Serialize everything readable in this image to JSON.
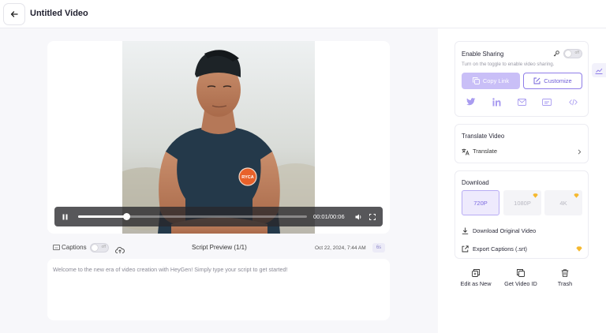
{
  "header": {
    "title": "Untitled Video",
    "back_icon": "arrow-left-icon"
  },
  "player": {
    "current_time": "00:01",
    "duration": "00:06",
    "time_display": "00:01/00:06",
    "progress": 0.21,
    "avatar_badge": "RYCA"
  },
  "below_video": {
    "captions_label": "Captions",
    "captions_toggle_text": "off",
    "script_preview": "Script Preview (1/1)",
    "date": "Oct 22, 2024, 7:44 AM",
    "duration_badge": "6s"
  },
  "script": {
    "text": "Welcome to the new era of video creation with HeyGen! Simply type your script to get started!"
  },
  "sharing": {
    "title": "Enable Sharing",
    "hint": "Turn on the toggle to enable video sharing.",
    "toggle_text": "off",
    "copy_link": "Copy Link",
    "customize": "Customize",
    "icons": [
      "twitter-icon",
      "linkedin-icon",
      "mail-icon",
      "embed-icon",
      "code-icon"
    ]
  },
  "translate": {
    "title": "Translate Video",
    "item": "Translate"
  },
  "download": {
    "title": "Download",
    "resolutions": [
      {
        "label": "720P",
        "selected": true,
        "premium": false
      },
      {
        "label": "1080P",
        "selected": false,
        "premium": true
      },
      {
        "label": "4K",
        "selected": false,
        "premium": true
      }
    ],
    "original": "Download Original Video",
    "captions": "Export Captions (.srt)"
  },
  "actions": {
    "edit": "Edit as New",
    "video_id": "Get Video ID",
    "trash": "Trash"
  },
  "colors": {
    "accent": "#8f7de8",
    "accent_light": "#c9bff7",
    "gem": "#f5b82e",
    "player_bar": "#28282c"
  }
}
